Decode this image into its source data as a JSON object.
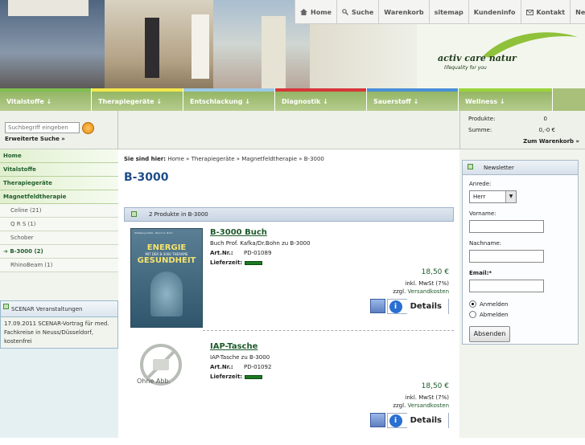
{
  "topnav": {
    "items": [
      {
        "label": "Home",
        "icon": "home-icon"
      },
      {
        "label": "Suche",
        "icon": "search-icon"
      },
      {
        "label": "Warenkorb"
      },
      {
        "label": "sitemap"
      },
      {
        "label": "Kundeninfo"
      },
      {
        "label": "Kontakt",
        "icon": "mail-icon"
      },
      {
        "label": "Newsletter"
      }
    ]
  },
  "logo": {
    "text": "activ care natur",
    "tagline": "lifequality for you"
  },
  "categories": [
    {
      "label": "Vitalstoffe",
      "color": "#7fbf4f"
    },
    {
      "label": "Therapiegeräte",
      "color": "#f2e84a"
    },
    {
      "label": "Entschlackung",
      "color": "#9bc9e8"
    },
    {
      "label": "Diagnostik",
      "color": "#d6373a"
    },
    {
      "label": "Sauerstoff",
      "color": "#4a8fd6"
    },
    {
      "label": "Wellness",
      "color": "#9ad43a"
    }
  ],
  "search": {
    "placeholder": "Suchbegriff eingeben",
    "advanced": "Erweiterte Suche »"
  },
  "cart": {
    "products_label": "Produkte:",
    "products_value": "0",
    "sum_label": "Summe:",
    "sum_value": "0,-0 €",
    "link": "Zum Warenkorb »"
  },
  "leftnav": {
    "main": [
      "Home",
      "Vitalstoffe",
      "Therapiegeräte",
      "Magnetfeldtherapie"
    ],
    "sub": [
      "Celine (21)",
      "Q R S (1)",
      "Schober",
      "B-3000 (2)",
      "RhinoBeam (1)"
    ]
  },
  "scenar": {
    "title": "SCENAR Veranstaltungen",
    "body": "17.09.2011 SCENAR-Vortrag für med. Fachkreise in Neuss/Düsseldorf, kostenfrei"
  },
  "breadcrumb": {
    "label": "Sie sind hier:",
    "path": "Home » Therapiegeräte » Magnetfeldtherapie » B-3000"
  },
  "page_title": "B-3000",
  "listing_header": "2 Produkte in B-3000",
  "products": [
    {
      "name": "B-3000 Buch",
      "desc": "Buch Prof. Kafka/Dr.Bohn zu B-3000",
      "artnr_label": "Art.Nr.:",
      "artnr": "PD-01089",
      "lief_label": "Lieferzeit:",
      "price": "18,50 €",
      "tax": "inkl. MwSt (7%)",
      "shipping_prefix": "zzgl.",
      "shipping_link": "Versandkosten",
      "details": "Details",
      "book": {
        "author": "Wolfgang Kafka · Bernd G. Bohn",
        "line1": "ENERGIE",
        "line2": "GESUNDHEIT",
        "sub": "MIT DER B-3000 THERAPIE"
      }
    },
    {
      "name": "IAP-Tasche",
      "desc": "IAP-Tasche zu B-3000",
      "artnr_label": "Art.Nr.:",
      "artnr": "PD-01092",
      "lief_label": "Lieferzeit:",
      "price": "18,50 €",
      "tax": "inkl. MwSt (7%)",
      "shipping_prefix": "zzgl.",
      "shipping_link": "Versandkosten",
      "details": "Details",
      "noimage": "Ohne Abb."
    }
  ],
  "newsletter": {
    "title": "Newsletter",
    "salutation_label": "Anrede:",
    "salutation_value": "Herr",
    "firstname_label": "Vorname:",
    "lastname_label": "Nachname:",
    "email_label": "Email:*",
    "subscribe": "Anmelden",
    "unsubscribe": "Abmelden",
    "submit": "Absenden"
  }
}
